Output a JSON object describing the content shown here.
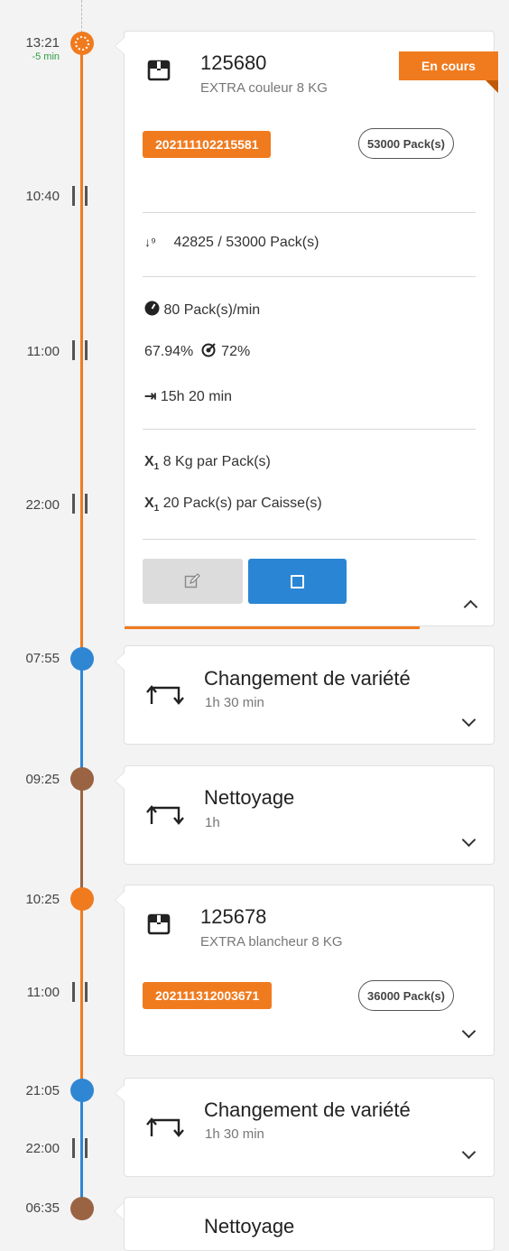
{
  "timeline": {
    "colors": {
      "orange": "#f07b1f",
      "blue": "#2f86d3",
      "brown": "#9a6443",
      "green": "#2e9e3e"
    },
    "entries": [
      {
        "time": "13:21",
        "delta": "-5 min",
        "type": "production"
      },
      {
        "time": "10:40",
        "type": "tick"
      },
      {
        "time": "11:00",
        "type": "tick"
      },
      {
        "time": "22:00",
        "type": "tick"
      },
      {
        "time": "07:55",
        "type": "changeover"
      },
      {
        "time": "09:25",
        "type": "cleaning"
      },
      {
        "time": "10:25",
        "type": "production"
      },
      {
        "time": "11:00",
        "type": "tick"
      },
      {
        "time": "21:05",
        "type": "changeover"
      },
      {
        "time": "22:00",
        "type": "tick"
      },
      {
        "time": "06:35",
        "type": "cleaning"
      }
    ]
  },
  "card1": {
    "order": "125680",
    "product": "EXTRA couleur 8 KG",
    "status": "En cours",
    "lot": "202111102215581",
    "quantity": "53000 Pack(s)",
    "counter": "42825 / 53000 Pack(s)",
    "speed": "80 Pack(s)/min",
    "efficiency": "67.94%",
    "target": "72%",
    "remaining": "15h 20 min",
    "weight_per_pack": "8 Kg par Pack(s)",
    "packs_per_case": "20 Pack(s) par Caisse(s)",
    "progress_fraction": 0.8,
    "icons": {
      "product": "package-icon",
      "counter": "sort-numeric-icon",
      "speed": "speedometer-icon",
      "target": "target-icon",
      "remaining": "arrow-to-end-icon",
      "multiplier": "multiplier-icon",
      "edit": "edit-icon",
      "stop": "stop-icon",
      "collapse": "chevron-up-icon"
    }
  },
  "card2": {
    "title": "Changement de variété",
    "duration": "1h 30 min"
  },
  "card3": {
    "title": "Nettoyage",
    "duration": "1h"
  },
  "card4": {
    "order": "125678",
    "product": "EXTRA blancheur 8 KG",
    "lot": "202111312003671",
    "quantity": "36000 Pack(s)"
  },
  "card5": {
    "title": "Changement de variété",
    "duration": "1h 30 min"
  },
  "card6": {
    "title": "Nettoyage"
  }
}
